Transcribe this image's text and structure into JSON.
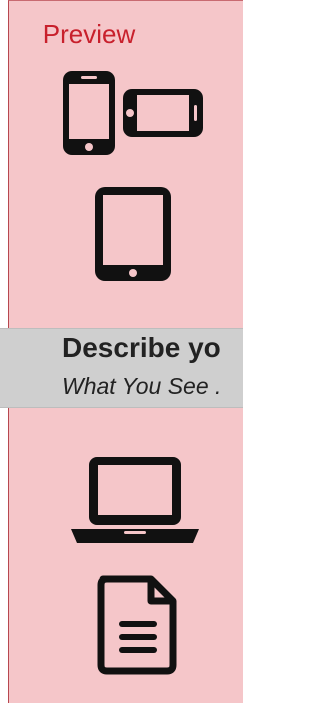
{
  "panel": {
    "title": "Preview",
    "icons": [
      "phone-portrait-icon",
      "phone-landscape-icon",
      "tablet-icon",
      "laptop-icon",
      "document-icon"
    ]
  },
  "overlay": {
    "title": "Describe yo",
    "subtitle": "What You See ."
  },
  "colors": {
    "panel_bg": "#f5c6c9",
    "panel_border": "#b7474f",
    "title_red": "#c8202c",
    "overlay_bg": "#cfcfcf",
    "icon": "#111111"
  }
}
